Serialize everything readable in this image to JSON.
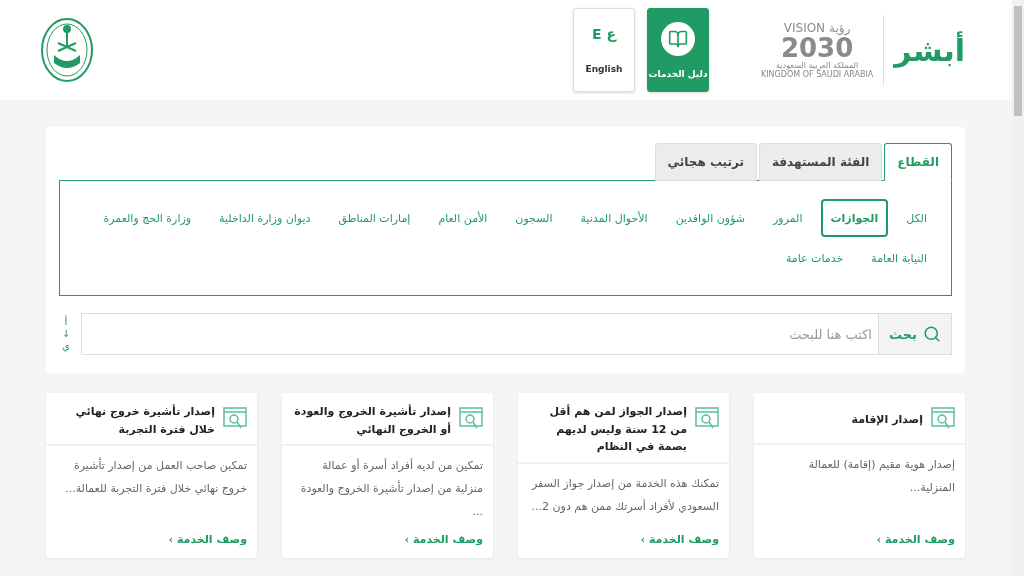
{
  "header": {
    "logo": {
      "brand": "أبشر",
      "vision": "VISION",
      "vision_ar": "رؤية",
      "year": "2030",
      "country_ar": "المملكة العربية السعودية",
      "country_en": "KINGDOM OF SAUDI ARABIA"
    },
    "nav": [
      {
        "kind": "guide",
        "label": "دليل الخدمات",
        "selected": true
      },
      {
        "kind": "language",
        "label": "English",
        "glyph": "ع E",
        "selected": false
      }
    ]
  },
  "tabs": [
    {
      "label": "القطاع",
      "selected": true
    },
    {
      "label": "الفئة المستهدفة",
      "selected": false
    },
    {
      "label": "ترتيب هجائي",
      "selected": false
    }
  ],
  "sectors": [
    {
      "label": "الكل",
      "selected": false
    },
    {
      "label": "الجوازات",
      "selected": true
    },
    {
      "label": "المرور",
      "selected": false
    },
    {
      "label": "شؤون الوافدين",
      "selected": false
    },
    {
      "label": "الأحوال المدنية",
      "selected": false
    },
    {
      "label": "السجون",
      "selected": false
    },
    {
      "label": "الأمن العام",
      "selected": false
    },
    {
      "label": "إمارات المناطق",
      "selected": false
    },
    {
      "label": "ديوان وزارة الداخلية",
      "selected": false
    },
    {
      "label": "وزارة الحج والعمرة",
      "selected": false
    },
    {
      "label": "النيابة العامة",
      "selected": false
    },
    {
      "label": "خدمات عامة",
      "selected": false
    }
  ],
  "search": {
    "button": "بحث",
    "placeholder": "اكتب هنا للبحث",
    "sort": [
      "أ",
      "↓",
      "ي"
    ]
  },
  "cards": [
    {
      "title": "إصدار الإقامة",
      "description": "إصدار هوية مقيم (إقامة) للعمالة المنزلية...",
      "link": "وصف الخدمة ›"
    },
    {
      "title": "إصدار الجواز لمن هم أقل من 12 سنة وليس لديهم بصمة في النظام",
      "description": "تمكنك هذه الخدمة من إصدار جواز السفر السعودي لأفراد أسرتك ممن هم دون 2...",
      "link": "وصف الخدمة ›"
    },
    {
      "title": "إصدار تأشيرة الخروج والعودة أو الخروج النهائي",
      "description": "تمكين من لديه أفراد أسرة أو عمالة منزلية من إصدار تأشيرة الخروج والعودة ...",
      "link": "وصف الخدمة ›"
    },
    {
      "title": "إصدار تأشيرة خروج نهائي خلال فترة التجربة",
      "description": "تمكين صاحب العمل من إصدار تأشيرة خروج نهائي خلال فترة التجربة للعمالة...",
      "link": "وصف الخدمة ›"
    }
  ]
}
